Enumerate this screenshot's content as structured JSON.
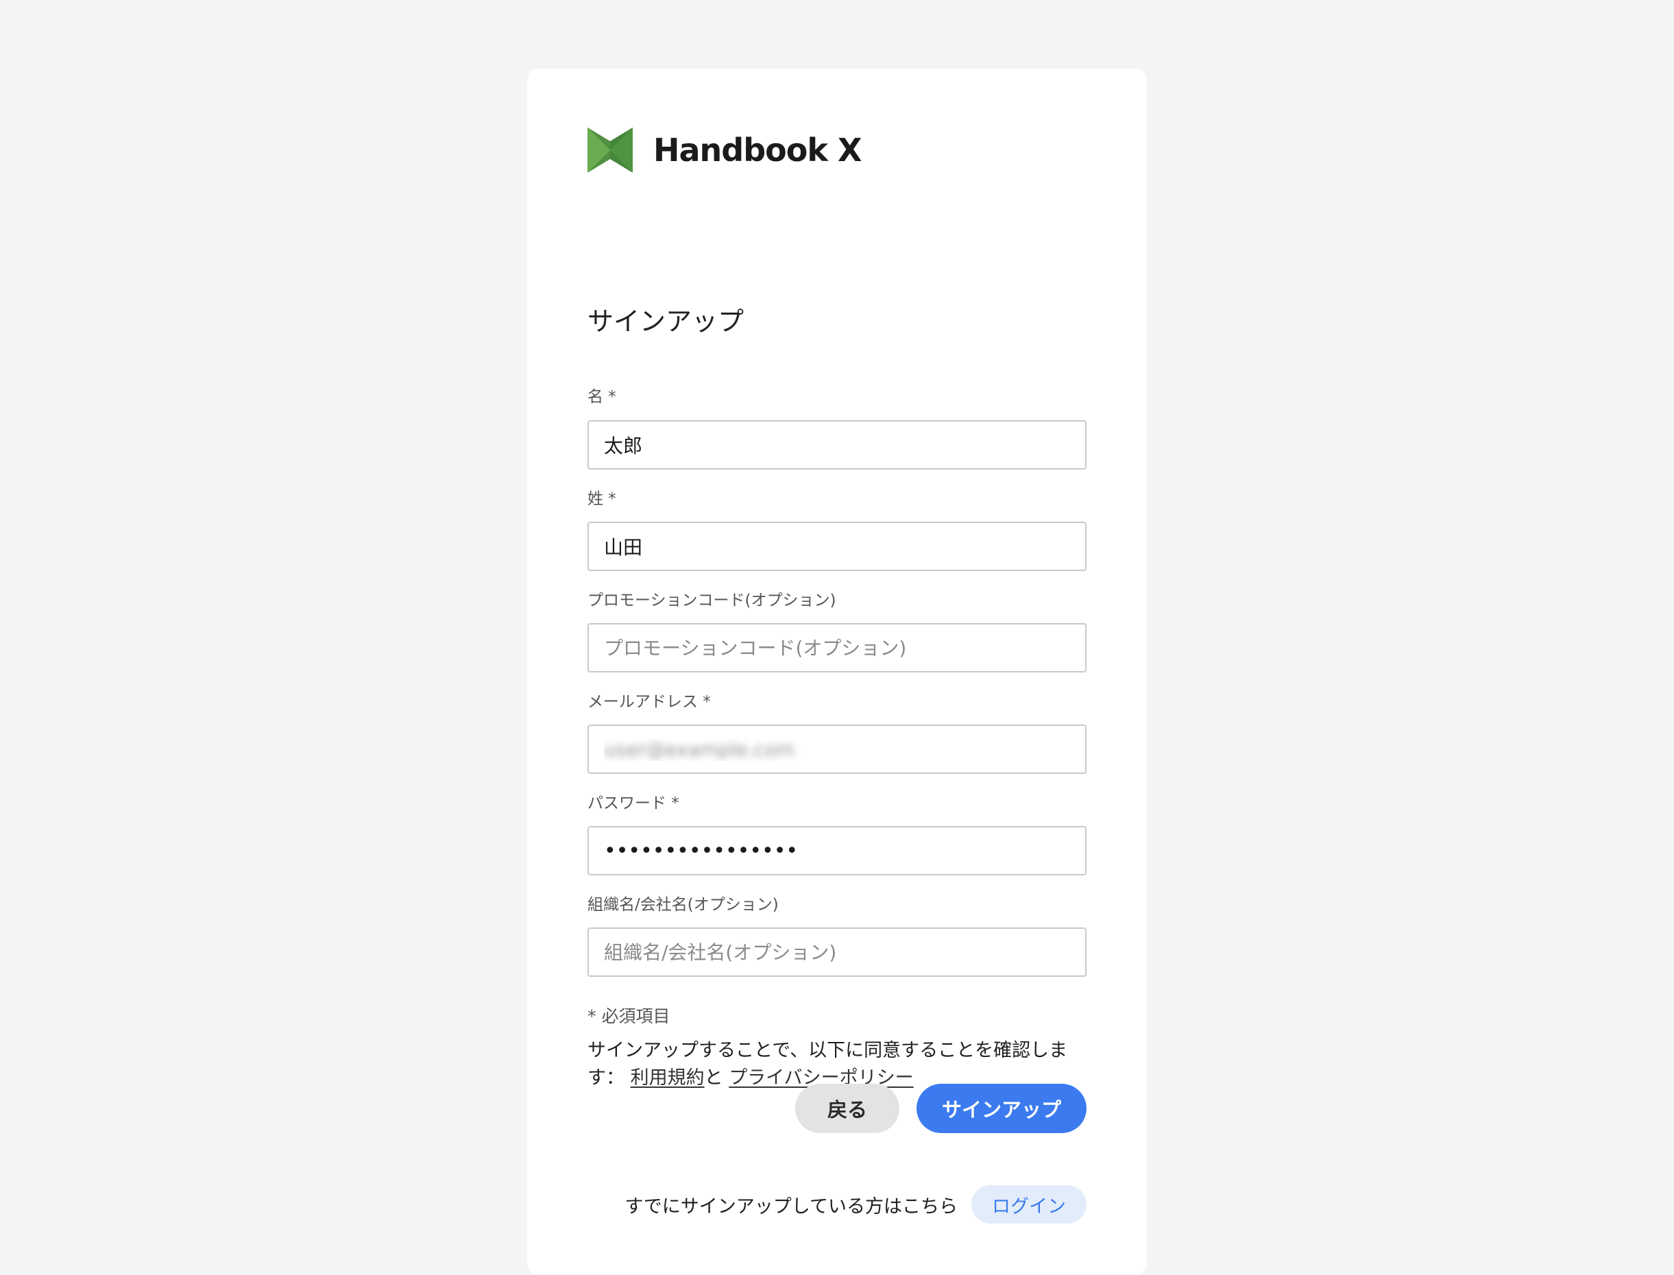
{
  "brand": {
    "name": "Handbook X",
    "logo_icon": "handbook-x-logo-icon",
    "colors": {
      "logo_light": "#6aab4f",
      "logo_dark": "#3d7a35"
    }
  },
  "form": {
    "title": "サインアップ",
    "first_name": {
      "label": "名 *",
      "value": "太郎",
      "placeholder": ""
    },
    "last_name": {
      "label": "姓 *",
      "value": "山田",
      "placeholder": ""
    },
    "promo_code": {
      "label": "プロモーションコード(オプション)",
      "value": "",
      "placeholder": "プロモーションコード(オプション)"
    },
    "email": {
      "label": "メールアドレス *",
      "value": "",
      "display": "user@example.com",
      "note": "value blurred"
    },
    "password": {
      "label": "パスワード *",
      "value": "••••••••••••••••"
    },
    "organization": {
      "label": "組織名/会社名(オプション)",
      "value": "",
      "placeholder": "組織名/会社名(オプション)"
    },
    "required_note": "* 必須項目",
    "agreement_prefix": "サインアップすることで、以下に同意することを確認しま",
    "agreement_prefix2": "す：",
    "terms_link": "利用規約",
    "and_text": "と",
    "privacy_link": "プライバシーポリシー"
  },
  "actions": {
    "back_label": "戻る",
    "signup_label": "サインアップ",
    "login_prompt": "すでにサインアップしている方はこちら",
    "login_label": "ログイン"
  },
  "colors": {
    "primary": "#3b7bef",
    "secondary_button": "#e3e3e3",
    "login_chip": "#e3ecfb",
    "page_bg": "#f3f4f6"
  }
}
